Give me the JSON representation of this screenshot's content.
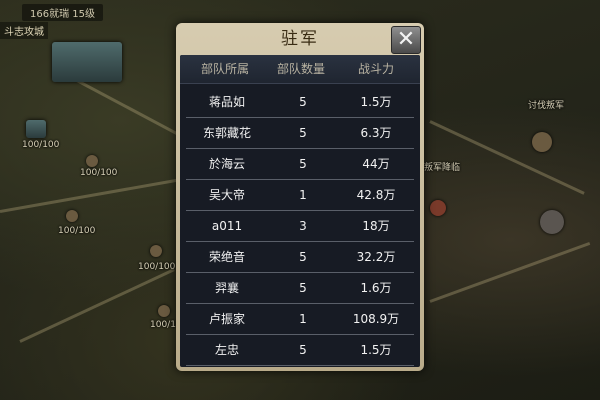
{
  "map": {
    "header": "166就瑞 15级",
    "banner": "斗志攻城",
    "labels": [
      "100/100",
      "100/100",
      "100/100",
      "100/100",
      "100/100",
      "讨伐叛军",
      "叛军降临"
    ]
  },
  "dialog": {
    "title": "驻军",
    "close_icon": "close-icon",
    "columns": [
      "部队所属",
      "部队数量",
      "战斗力"
    ],
    "rows": [
      {
        "name": "蒋品如",
        "count": "5",
        "power": "1.5万"
      },
      {
        "name": "东郭藏花",
        "count": "5",
        "power": "6.3万"
      },
      {
        "name": "於海云",
        "count": "5",
        "power": "44万"
      },
      {
        "name": "吴大帝",
        "count": "1",
        "power": "42.8万"
      },
      {
        "name": "a011",
        "count": "3",
        "power": "18万"
      },
      {
        "name": "荣绝音",
        "count": "5",
        "power": "32.2万"
      },
      {
        "name": "羿襄",
        "count": "5",
        "power": "1.6万"
      },
      {
        "name": "卢振家",
        "count": "1",
        "power": "108.9万"
      },
      {
        "name": "左忠",
        "count": "5",
        "power": "1.5万"
      }
    ]
  }
}
